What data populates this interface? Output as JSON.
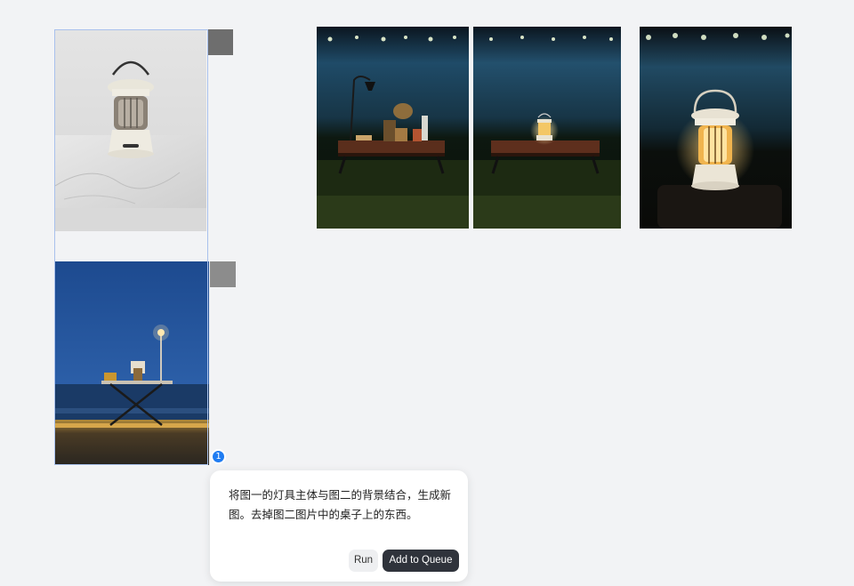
{
  "canvas": {
    "background": "#f2f3f5"
  },
  "input_images": [
    {
      "name": "image-1",
      "subject": "white vintage camping lantern on marble table"
    },
    {
      "name": "image-2",
      "subject": "folding table on beach at dusk with lamp post"
    }
  ],
  "output_images": [
    {
      "name": "result-1",
      "subject": "lamp and kettle on wooden table by waterside at night"
    },
    {
      "name": "result-2",
      "subject": "lantern on wooden table by waterside at night"
    },
    {
      "name": "result-3",
      "subject": "close-up of glowing lantern at night"
    }
  ],
  "selection": {
    "badge_count": "1",
    "badge_color": "#1f7cf2"
  },
  "prompt": {
    "text_line1": "将图一的灯具主体与图二的背景结合，生成新",
    "text_line2": "图。去掉图二图片中的桌子上的东西。",
    "run_label": "Run",
    "queue_label": "Add to Queue"
  },
  "colors": {
    "selection_outline": "#a9c1ec",
    "queue_button": "#2f333b",
    "run_button": "#eeeff1"
  }
}
